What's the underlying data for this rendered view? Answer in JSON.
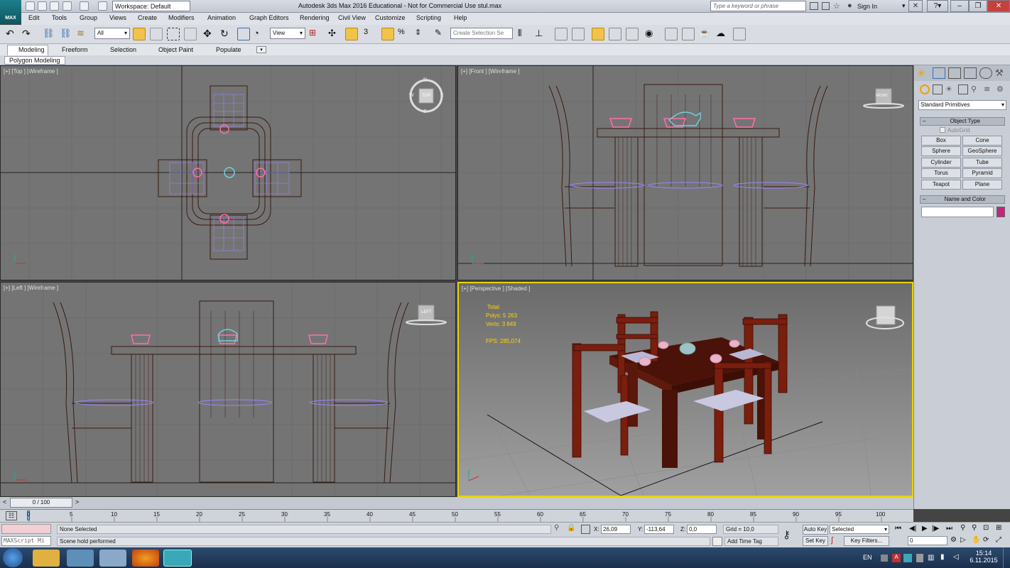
{
  "app": {
    "title": "Autodesk 3ds Max 2016 Educational - Not for Commercial Use   stul.max",
    "logo_label": "MAX",
    "workspace": "Workspace: Default",
    "search_placeholder": "Type a keyword or phrase",
    "sign_in": "Sign In"
  },
  "menu": [
    "Edit",
    "Tools",
    "Group",
    "Views",
    "Create",
    "Modifiers",
    "Animation",
    "Graph Editors",
    "Rendering",
    "Civil View",
    "Customize",
    "Scripting",
    "Help"
  ],
  "toolbar": {
    "filter": "All",
    "ref_coord": "View",
    "selection_set_placeholder": "Create Selection Se",
    "snap_label": "3",
    "percent_label": "%"
  },
  "ribbon": {
    "tabs": [
      "Modeling",
      "Freeform",
      "Selection",
      "Object Paint",
      "Populate"
    ],
    "subtab": "Polygon Modeling"
  },
  "viewports": {
    "top": "[+] [Top ] [Wireframe ]",
    "front": "[+] [Front ] [Wireframe ]",
    "left": "[+] [Left ] [Wireframe ]",
    "perspective": "[+] [Perspective ] [Shaded ]",
    "compass_n": "N",
    "compass_e": "E",
    "compass_s": "S",
    "compass_w": "W",
    "cube_top": "TOP",
    "cube_front": "FRONT",
    "cube_left": "LEFT",
    "stats": {
      "total": "Total",
      "polys_label": "Polys:",
      "polys": "5 263",
      "verts_label": "Verts:",
      "verts": "3 849",
      "fps_label": "FPS:",
      "fps": "285,074"
    }
  },
  "command_panel": {
    "dropdown": "Standard Primitives",
    "object_type": "Object Type",
    "autogrid": "AutoGrid",
    "buttons": [
      "Box",
      "Cone",
      "Sphere",
      "GeoSphere",
      "Cylinder",
      "Tube",
      "Torus",
      "Pyramid",
      "Teapot",
      "Plane"
    ],
    "name_color": "Name and Color",
    "color_swatch": "#c0287a"
  },
  "timeline": {
    "frame": "0 / 100",
    "ticks": [
      "0",
      "5",
      "10",
      "15",
      "20",
      "25",
      "30",
      "35",
      "40",
      "45",
      "50",
      "55",
      "60",
      "65",
      "70",
      "75",
      "80",
      "85",
      "90",
      "95",
      "100"
    ]
  },
  "status": {
    "selection": "None Selected",
    "prompt": "Scene hold performed",
    "maxscript": "MAXScript Mi",
    "x_label": "X:",
    "x": "26,09",
    "y_label": "Y:",
    "y": "-113,64",
    "z_label": "Z:",
    "z": "0,0",
    "grid": "Grid = 10,0",
    "add_time_tag": "Add Time Tag",
    "auto_key": "Auto Key",
    "set_key": "Set Key",
    "key_mode": "Selected",
    "key_filters": "Key Filters...",
    "current_frame": "0"
  },
  "taskbar": {
    "lang": "EN",
    "time": "15:14",
    "date": "6.11.2015"
  }
}
